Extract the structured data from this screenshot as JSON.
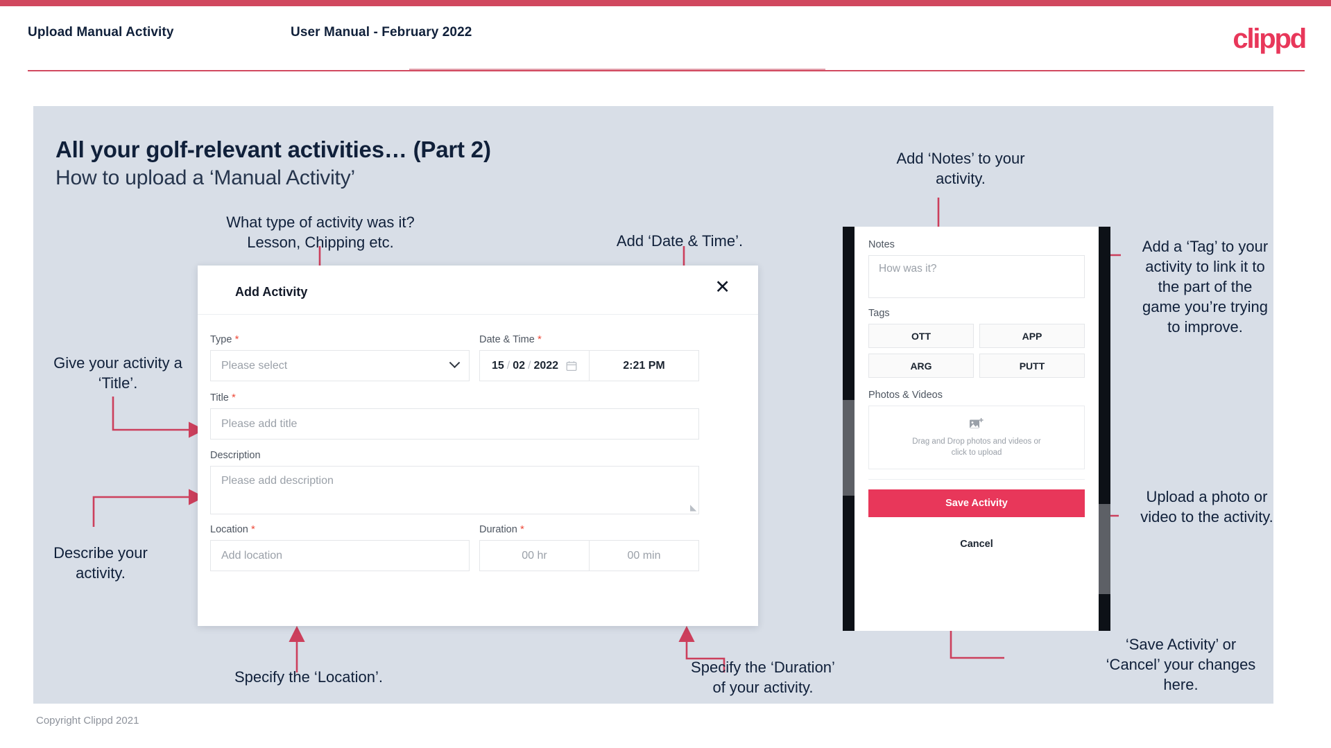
{
  "header": {
    "title": "Upload Manual Activity",
    "subtitle": "User Manual - February 2022",
    "brand": "clippd",
    "accent_color": "#e8375a",
    "rule_color": "#d1485f"
  },
  "slide": {
    "heading": "All your golf-relevant activities… (Part 2)",
    "subheading": "How to upload a ‘Manual Activity’",
    "background_color": "#d8dee7"
  },
  "footer": {
    "copyright": "Copyright Clippd 2021"
  },
  "annotations": [
    {
      "id": "type",
      "text": "What type of activity was it?\nLesson, Chipping etc."
    },
    {
      "id": "datetime",
      "text": "Add ‘Date & Time’."
    },
    {
      "id": "notes",
      "text": "Add ‘Notes’ to your\nactivity."
    },
    {
      "id": "tag",
      "text": "Add a ‘Tag’ to your\nactivity to link it to\nthe part of the\ngame you’re trying\nto improve."
    },
    {
      "id": "title",
      "text": "Give your activity a\n‘Title’."
    },
    {
      "id": "description",
      "text": "Describe your\nactivity."
    },
    {
      "id": "upload",
      "text": "Upload a photo or\nvideo to the activity."
    },
    {
      "id": "location",
      "text": "Specify the ‘Location’."
    },
    {
      "id": "duration",
      "text": "Specify the ‘Duration’\nof your activity."
    },
    {
      "id": "savecancel",
      "text": "‘Save Activity’ or\n‘Cancel’ your changes\nhere."
    }
  ],
  "dialog": {
    "title": "Add Activity",
    "close_icon": "close-icon",
    "fields": {
      "type": {
        "label": "Type",
        "required": true,
        "placeholder": "Please select"
      },
      "datetime": {
        "label": "Date & Time",
        "required": true,
        "day": "15",
        "month": "02",
        "year": "2022",
        "separator": "/",
        "time": "2:21 PM",
        "calendar_icon": "calendar-icon"
      },
      "title": {
        "label": "Title",
        "required": true,
        "placeholder": "Please add title"
      },
      "description": {
        "label": "Description",
        "required": false,
        "placeholder": "Please add description"
      },
      "location": {
        "label": "Location",
        "required": true,
        "placeholder": "Add location"
      },
      "duration": {
        "label": "Duration",
        "required": true,
        "hours": "00 hr",
        "minutes": "00 min"
      }
    }
  },
  "phone": {
    "notes": {
      "label": "Notes",
      "placeholder": "How was it?"
    },
    "tags": {
      "label": "Tags",
      "items": [
        "OTT",
        "APP",
        "ARG",
        "PUTT"
      ]
    },
    "photos": {
      "label": "Photos & Videos",
      "icon": "add-image-icon",
      "line1": "Drag and Drop photos and videos or",
      "line2": "click to upload"
    },
    "save_label": "Save Activity",
    "cancel_label": "Cancel",
    "save_color": "#e8375a"
  }
}
